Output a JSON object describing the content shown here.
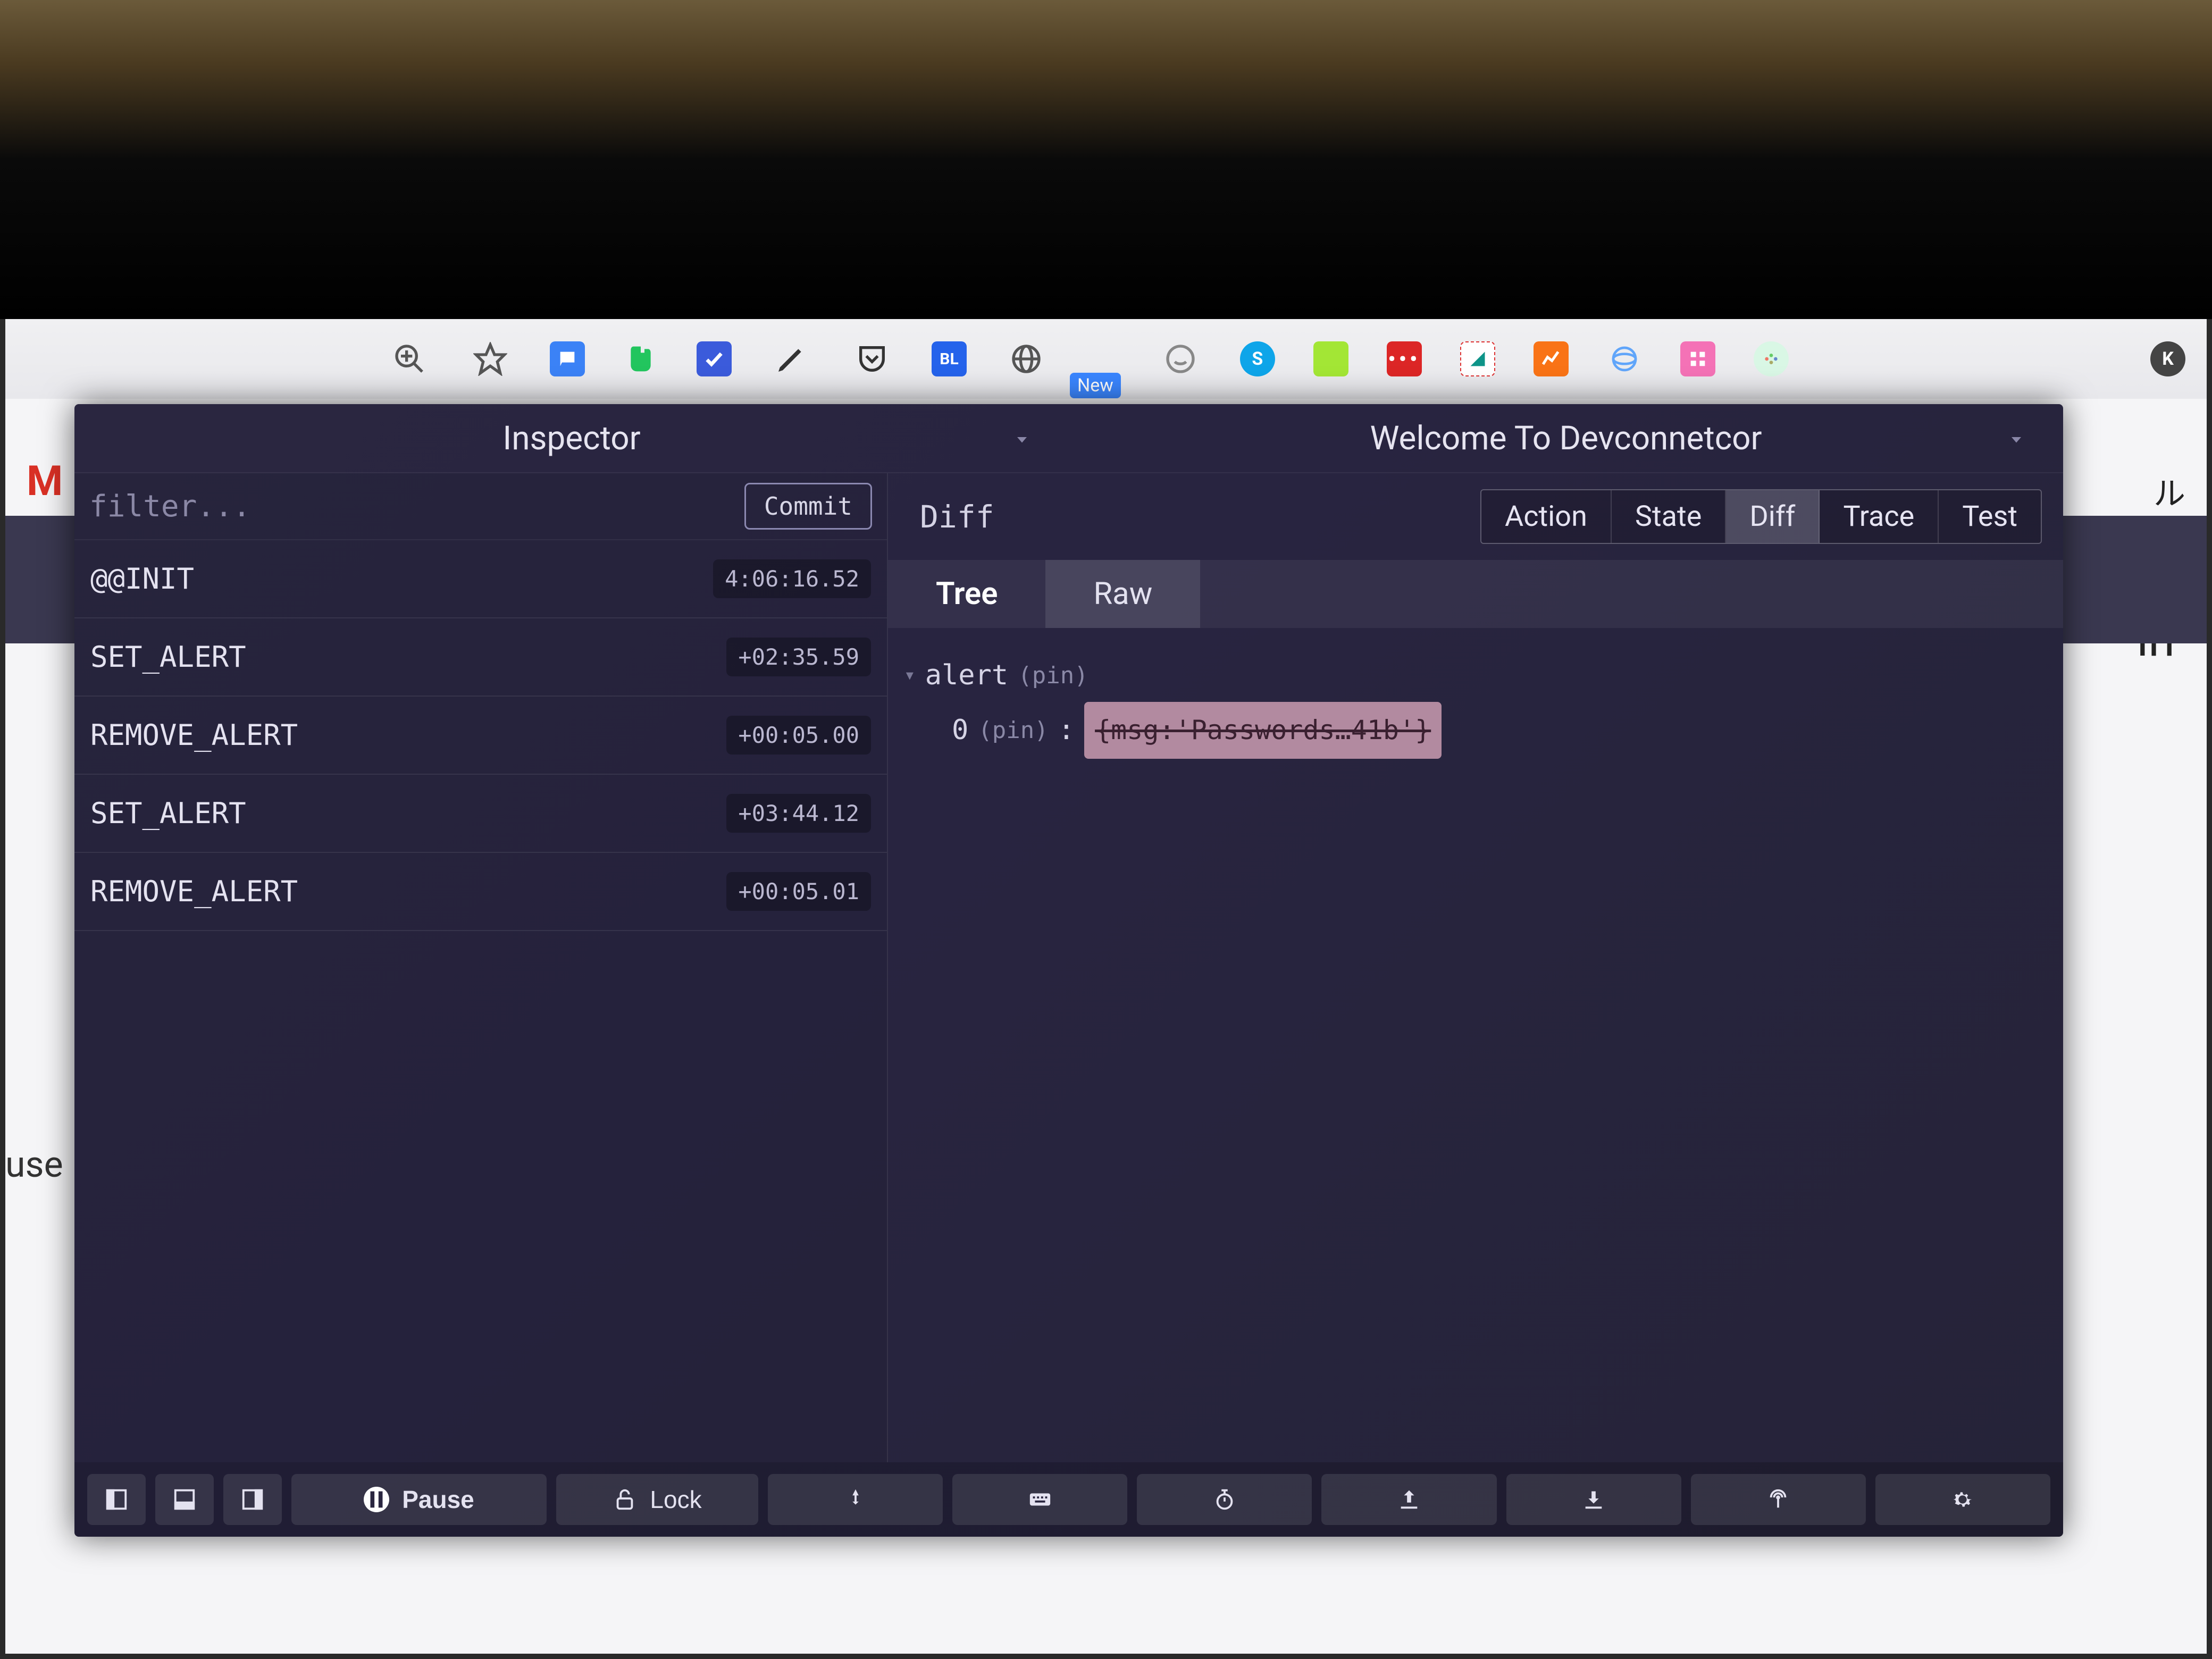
{
  "browser": {
    "new_badge": "New",
    "avatar_letter": "K"
  },
  "underlay": {
    "mail_fragment": "M",
    "in_fragment": "in",
    "use_fragment": "use",
    "ru_fragment": "ル"
  },
  "header": {
    "left_title": "Inspector",
    "right_title": "Welcome To Devconnetcor"
  },
  "left": {
    "filter_placeholder": "filter...",
    "commit_label": "Commit",
    "actions": [
      {
        "name": "@@INIT",
        "time": "4:06:16.52"
      },
      {
        "name": "SET_ALERT",
        "time": "+02:35.59"
      },
      {
        "name": "REMOVE_ALERT",
        "time": "+00:05.00"
      },
      {
        "name": "SET_ALERT",
        "time": "+03:44.12"
      },
      {
        "name": "REMOVE_ALERT",
        "time": "+00:05.01"
      }
    ]
  },
  "right": {
    "panel_label": "Diff",
    "tabs": [
      "Action",
      "State",
      "Diff",
      "Trace",
      "Test"
    ],
    "active_tab": "Diff",
    "subtabs": [
      "Tree",
      "Raw"
    ],
    "active_subtab": "Tree",
    "tree": {
      "root_key": "alert",
      "pin_label": "(pin)",
      "child_key": "0",
      "child_colon": ":",
      "deleted_value": "{msg:'Passwords…41b'}"
    }
  },
  "bottom": {
    "pause_label": "Pause",
    "lock_label": "Lock"
  }
}
